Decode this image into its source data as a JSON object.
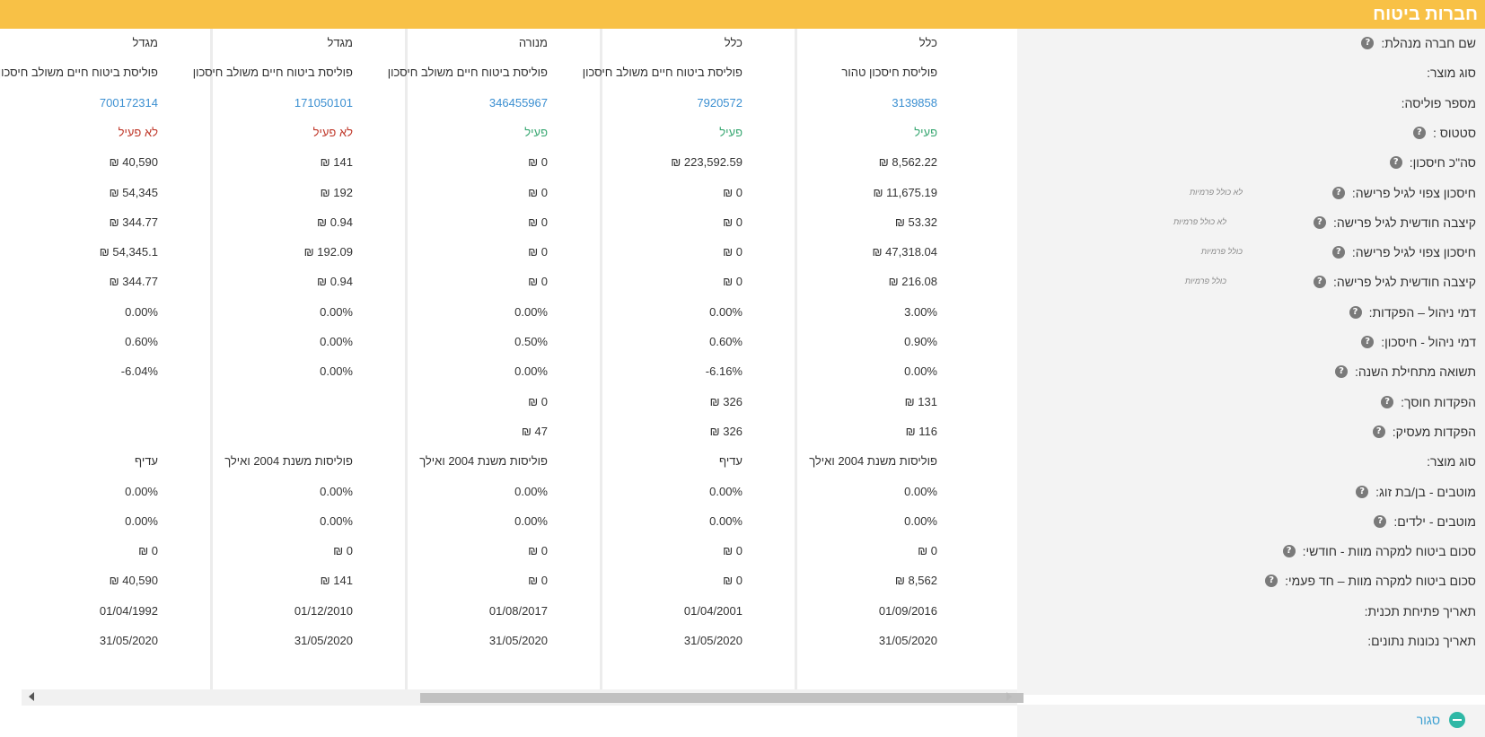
{
  "header": {
    "title": "חברות ביטוח"
  },
  "rows": [
    {
      "label": "שם חברה מנהלת:",
      "help": true,
      "values": [
        "כלל",
        "כלל",
        "מנורה",
        "מגדל",
        "מגדל"
      ]
    },
    {
      "label": "סוג מוצר:",
      "help": false,
      "values": [
        "פוליסת חיסכון טהור",
        "פוליסת ביטוח חיים משולב חיסכון",
        "פוליסת ביטוח חיים משולב חיסכון",
        "פוליסת ביטוח חיים משולב חיסכון",
        "פוליסת ביטוח חיים משולב חיסכון"
      ]
    },
    {
      "label": "מספר פוליסה:",
      "help": false,
      "kind": "link",
      "values": [
        "3139858",
        "7920572",
        "346455967",
        "171050101",
        "700172314"
      ]
    },
    {
      "label": "סטטוס :",
      "help": true,
      "kind": "status",
      "values": [
        "פעיל",
        "פעיל",
        "פעיל",
        "לא פעיל",
        "לא פעיל"
      ]
    },
    {
      "label": "סה\"כ חיסכון:",
      "help": true,
      "values": [
        "₪ 8,562.22",
        "₪ 223,592.59",
        "₪ 0",
        "₪ 141",
        "₪ 40,590"
      ]
    },
    {
      "label": "חיסכון צפוי לגיל פרישה:",
      "help": true,
      "note": "לא כולל פרמיות",
      "values": [
        "₪ 11,675.19",
        "₪ 0",
        "₪ 0",
        "₪ 192",
        "₪ 54,345"
      ]
    },
    {
      "label": "קיצבה חודשית לגיל פרישה:",
      "help": true,
      "note": "לא כולל פרמיות",
      "values": [
        "₪ 53.32",
        "₪ 0",
        "₪ 0",
        "₪ 0.94",
        "₪ 344.77"
      ]
    },
    {
      "label": "חיסכון צפוי לגיל פרישה:",
      "help": true,
      "note": "כולל פרמיות",
      "values": [
        "₪ 47,318.04",
        "₪ 0",
        "₪ 0",
        "₪ 192.09",
        "₪ 54,345.1"
      ]
    },
    {
      "label": "קיצבה חודשית לגיל פרישה:",
      "help": true,
      "note": "כולל פרמיות",
      "values": [
        "₪ 216.08",
        "₪ 0",
        "₪ 0",
        "₪ 0.94",
        "₪ 344.77"
      ]
    },
    {
      "label": "דמי ניהול – הפקדות:",
      "help": true,
      "values": [
        "3.00%",
        "0.00%",
        "0.00%",
        "0.00%",
        "0.00%"
      ]
    },
    {
      "label": "דמי ניהול - חיסכון:",
      "help": true,
      "values": [
        "0.90%",
        "0.60%",
        "0.50%",
        "0.00%",
        "0.60%"
      ]
    },
    {
      "label": "תשואה מתחילת השנה:",
      "help": true,
      "values": [
        "0.00%",
        "-6.16%",
        "0.00%",
        "0.00%",
        "-6.04%"
      ]
    },
    {
      "label": "הפקדות חוסך:",
      "help": true,
      "values": [
        "₪ 131",
        "₪ 326",
        "₪ 0",
        "",
        ""
      ]
    },
    {
      "label": "הפקדות מעסיק:",
      "help": true,
      "values": [
        "₪ 116",
        "₪ 326",
        "₪ 47",
        "",
        ""
      ]
    },
    {
      "label": "סוג מוצר:",
      "help": false,
      "values": [
        "פוליסות משנת 2004 ואילך",
        "עדיף",
        "פוליסות משנת 2004 ואילך",
        "פוליסות משנת 2004 ואילך",
        "עדיף"
      ]
    },
    {
      "label": "מוטבים - בן/בת זוג:",
      "help": true,
      "values": [
        "0.00%",
        "0.00%",
        "0.00%",
        "0.00%",
        "0.00%"
      ]
    },
    {
      "label": "מוטבים - ילדים:",
      "help": true,
      "values": [
        "0.00%",
        "0.00%",
        "0.00%",
        "0.00%",
        "0.00%"
      ]
    },
    {
      "label": "סכום ביטוח למקרה מוות - חודשי:",
      "help": true,
      "values": [
        "₪ 0",
        "₪ 0",
        "₪ 0",
        "₪ 0",
        "₪ 0"
      ]
    },
    {
      "label": "סכום ביטוח למקרה מוות – חד פעמי:",
      "help": true,
      "values": [
        "₪ 8,562",
        "₪ 0",
        "₪ 0",
        "₪ 141",
        "₪ 40,590"
      ]
    },
    {
      "label": "תאריך פתיחת תכנית:",
      "help": false,
      "values": [
        "01/09/2016",
        "01/04/2001",
        "01/08/2017",
        "01/12/2010",
        "01/04/1992"
      ]
    },
    {
      "label": "תאריך נכונות נתונים:",
      "help": false,
      "values": [
        "31/05/2020",
        "31/05/2020",
        "31/05/2020",
        "31/05/2020",
        "31/05/2020"
      ]
    }
  ],
  "help_glyph": "?",
  "footer": {
    "close_label": "סגור"
  },
  "colors": {
    "header": "#f8c146",
    "link": "#3b8fd1",
    "active": "#3aa873",
    "inactive": "#c0392b"
  }
}
